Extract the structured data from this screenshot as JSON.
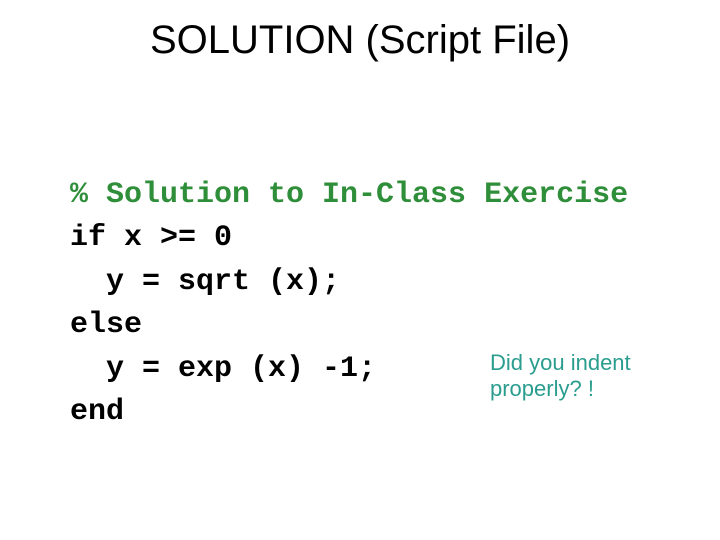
{
  "title": "SOLUTION (Script File)",
  "code": {
    "comment": "% Solution to In-Class Exercise",
    "line1": "if x >= 0",
    "line2": "  y = sqrt (x);",
    "line3": "else",
    "line4": "  y = exp (x) -1;",
    "line5": "end"
  },
  "annotation": "Did you indent properly? !"
}
